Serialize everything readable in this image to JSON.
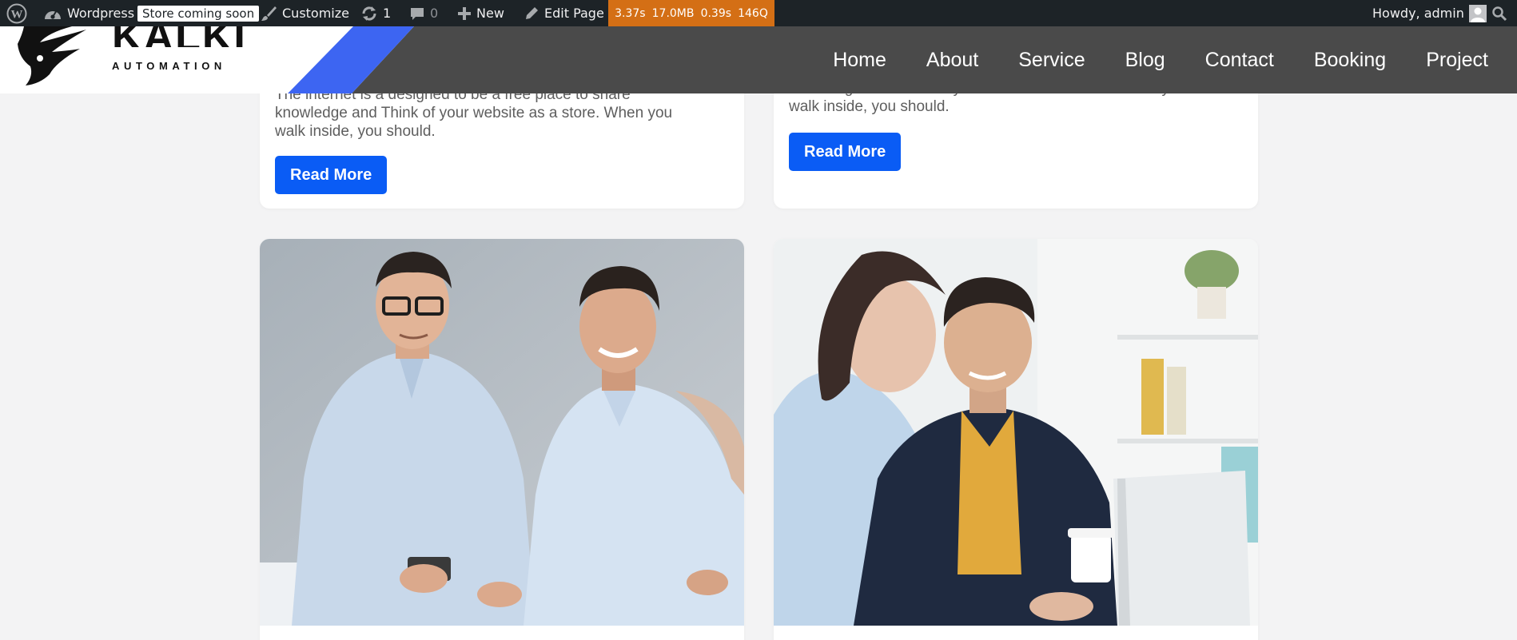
{
  "admin_bar": {
    "site_name": "Wordpress",
    "store_badge": "Store coming soon",
    "customize": "Customize",
    "updates_count": "1",
    "comments_count": "0",
    "new_label": "New",
    "edit_page": "Edit Page",
    "query_monitor": [
      "3.37s",
      "17.0MB",
      "0.39s",
      "146Q"
    ],
    "howdy": "Howdy, admin"
  },
  "header": {
    "logo_word": "KALKI",
    "logo_sub": "AUTOMATION",
    "nav": [
      "Home",
      "About",
      "Service",
      "Blog",
      "Contact",
      "Booking",
      "Project"
    ]
  },
  "cards": [
    {
      "excerpt_lines": [
        "The internet is a designed to be a free place to share",
        "knowledge and Think of your website as a store. When you",
        "walk inside, you should."
      ],
      "button": "Read More"
    },
    {
      "excerpt_lines": [
        "knowledge and Think of your website as a store. When you",
        "walk inside, you should."
      ],
      "button": "Read More"
    }
  ],
  "colors": {
    "admin_bar_bg": "#1d2327",
    "query_monitor_bg": "#d46f15",
    "nav_bg": "#4a4a4a",
    "accent_blue": "#3d65f2",
    "button_blue": "#0a5cf5",
    "page_bg": "#f3f3f4"
  },
  "icons": [
    "wordpress-logo-icon",
    "dashboard-icon",
    "brush-icon",
    "refresh-icon",
    "comment-icon",
    "plus-icon",
    "pencil-icon",
    "avatar-icon",
    "search-icon"
  ]
}
